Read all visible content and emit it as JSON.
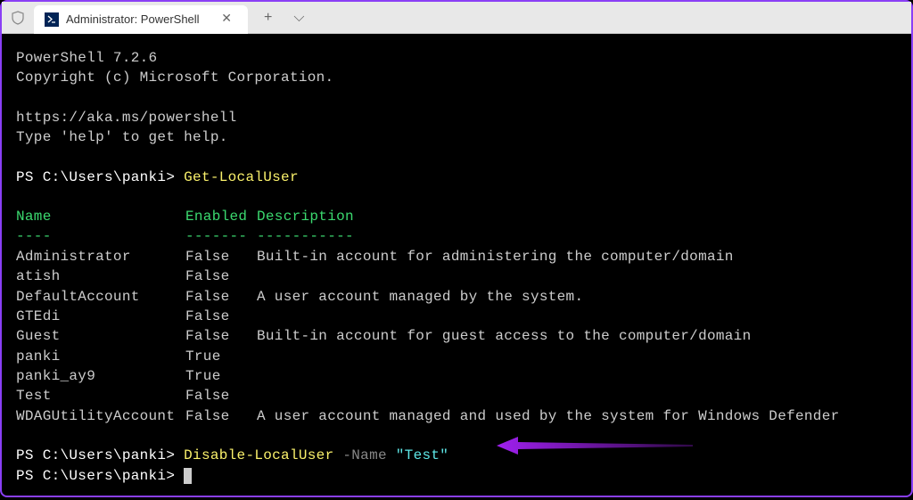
{
  "window": {
    "tab_title": "Administrator: PowerShell"
  },
  "header": {
    "version": "PowerShell 7.2.6",
    "copyright": "Copyright (c) Microsoft Corporation.",
    "url": "https://aka.ms/powershell",
    "help_hint": "Type 'help' to get help."
  },
  "prompts": {
    "p1": "PS C:\\Users\\panki> ",
    "p2": "PS C:\\Users\\panki> ",
    "p3": "PS C:\\Users\\panki> "
  },
  "commands": {
    "cmd1": "Get-LocalUser",
    "cmd2_a": "Disable-LocalUser",
    "cmd2_b": " -Name ",
    "cmd2_c": "\"Test\""
  },
  "table": {
    "col1": "Name",
    "col2": "Enabled",
    "col3": "Description",
    "sep1": "----",
    "sep2": "-------",
    "sep3": "-----------",
    "rows": [
      {
        "name": "Administrator     ",
        "enabled": "False  ",
        "desc": "Built-in account for administering the computer/domain"
      },
      {
        "name": "atish             ",
        "enabled": "False  ",
        "desc": ""
      },
      {
        "name": "DefaultAccount    ",
        "enabled": "False  ",
        "desc": "A user account managed by the system."
      },
      {
        "name": "GTEdi             ",
        "enabled": "False  ",
        "desc": ""
      },
      {
        "name": "Guest             ",
        "enabled": "False  ",
        "desc": "Built-in account for guest access to the computer/domain"
      },
      {
        "name": "panki             ",
        "enabled": "True   ",
        "desc": ""
      },
      {
        "name": "panki_ay9         ",
        "enabled": "True   ",
        "desc": ""
      },
      {
        "name": "Test              ",
        "enabled": "False  ",
        "desc": ""
      },
      {
        "name": "WDAGUtilityAccount",
        "enabled": "False  ",
        "desc": "A user account managed and used by the system for Windows Defender"
      }
    ]
  }
}
